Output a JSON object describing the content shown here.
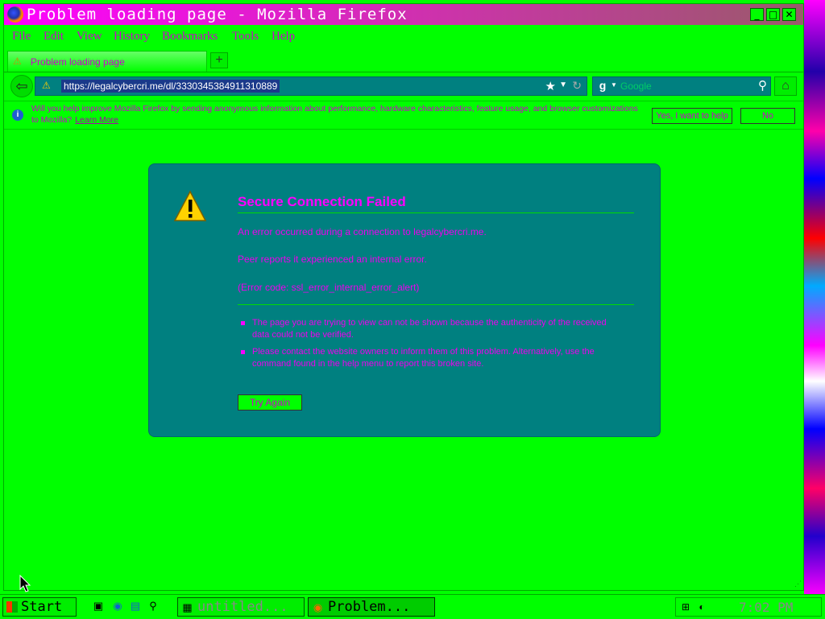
{
  "window": {
    "title": "Problem loading page - Mozilla Firefox",
    "controls": {
      "minimize": "_",
      "maximize": "□",
      "close": "✕"
    }
  },
  "menu": {
    "items": [
      "File",
      "Edit",
      "View",
      "History",
      "Bookmarks",
      "Tools",
      "Help"
    ]
  },
  "tabs": {
    "active_label": "Problem loading page",
    "new_tab": "+"
  },
  "navbar": {
    "url": "https://legalcybercri.me/dl/3330345384911310889",
    "search_placeholder": "Google"
  },
  "notification": {
    "message": "Will you help improve Mozilla Firefox by sending anonymous information about performance, hardware characteristics, feature usage, and browser customizations to Mozilla?",
    "learn_more": "Learn More",
    "accept": "Yes, I want to help",
    "decline": "No"
  },
  "error": {
    "title": "Secure Connection Failed",
    "line1": "An error occurred during a connection to legalcybercri.me.",
    "line2": "Peer reports it experienced an internal error.",
    "line3": "(Error code: ssl_error_internal_error_alert)",
    "bullets": [
      "The page you are trying to view can not be shown because the authenticity of the received data could not be verified.",
      "Please contact the website owners to inform them of this problem. Alternatively, use the command found in the help menu to report this broken site."
    ],
    "try_again": "Try Again"
  },
  "taskbar": {
    "start_label": "Start",
    "tasks": [
      "untitled...",
      "Problem..."
    ],
    "clock": "7:02 PM"
  },
  "colors": {
    "background": "#00ff00",
    "panel": "#008080",
    "text": "#ff00ff",
    "title_gradient_start": "#ff00ff",
    "title_gradient_end": "#9a5a6a"
  },
  "icons": {
    "app": "firefox-logo",
    "warning": "warning-triangle-icon",
    "info": "info-icon"
  }
}
